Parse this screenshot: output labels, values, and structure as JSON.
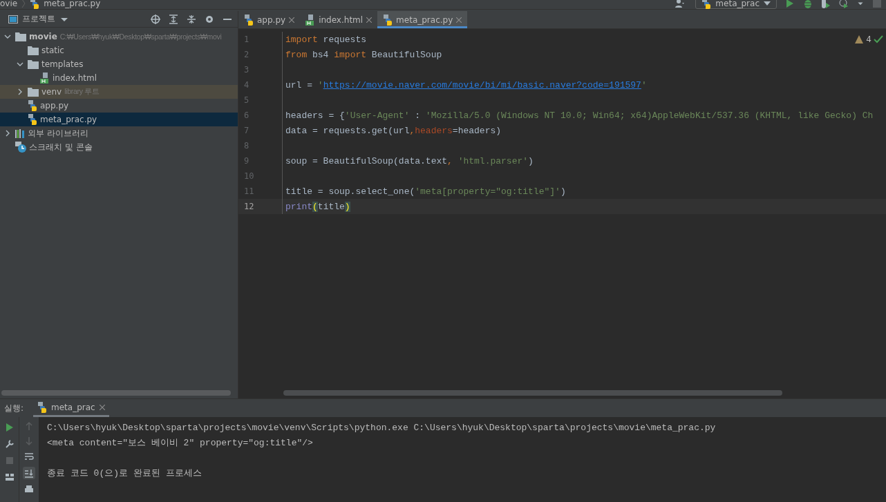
{
  "breadcrumb": {
    "project": "ovie",
    "file": "meta_prac.py"
  },
  "toolbar": {
    "run_config": "meta_prac"
  },
  "project_panel": {
    "title": "프로젝트",
    "tree": [
      {
        "label": "movie",
        "kind": "project_root",
        "hint": "C:₩Users₩hyuk₩Desktop₩sparta₩projects₩movi",
        "expanded": true,
        "selected": false,
        "children": [
          {
            "label": "static",
            "kind": "folder",
            "selected": false
          },
          {
            "label": "templates",
            "kind": "folder",
            "expanded": true,
            "selected": false,
            "children": [
              {
                "label": "index.html",
                "kind": "html",
                "selected": false
              }
            ]
          },
          {
            "label": "venv",
            "kind": "library_root",
            "hint": "library 루트",
            "expanded": false,
            "selected": false
          },
          {
            "label": "app.py",
            "kind": "python",
            "selected": false
          },
          {
            "label": "meta_prac.py",
            "kind": "python",
            "selected": true
          }
        ]
      },
      {
        "label": "외부 라이브러리",
        "kind": "libraries",
        "expanded": false,
        "selected": false
      },
      {
        "label": "스크래치 및 콘솔",
        "kind": "scratch",
        "selected": false
      }
    ]
  },
  "editor": {
    "tabs": [
      {
        "label": "app.py",
        "kind": "python",
        "selected": false
      },
      {
        "label": "index.html",
        "kind": "html",
        "selected": false
      },
      {
        "label": "meta_prac.py",
        "kind": "python",
        "selected": true
      }
    ],
    "warnings": "4",
    "lines": [
      {
        "number": "1",
        "current": false,
        "tokens": [
          {
            "kind": "keyword",
            "text": "import"
          },
          {
            "kind": "plain",
            "text": " requests"
          }
        ]
      },
      {
        "number": "2",
        "current": false,
        "tokens": [
          {
            "kind": "keyword",
            "text": "from"
          },
          {
            "kind": "plain",
            "text": " bs4 "
          },
          {
            "kind": "keyword",
            "text": "import"
          },
          {
            "kind": "plain",
            "text": " BeautifulSoup"
          }
        ]
      },
      {
        "number": "3",
        "current": false
      },
      {
        "number": "4",
        "current": false,
        "tokens": [
          {
            "kind": "plain",
            "text": "url = "
          },
          {
            "kind": "string",
            "text": "'"
          },
          {
            "kind": "link",
            "text": "https://movie.naver.com/movie/bi/mi/basic.naver?code=191597"
          },
          {
            "kind": "string",
            "text": "'"
          }
        ]
      },
      {
        "number": "5",
        "current": false
      },
      {
        "number": "6",
        "current": false,
        "tokens": [
          {
            "kind": "plain",
            "text": "headers = {"
          },
          {
            "kind": "string",
            "text": "'User-Agent'"
          },
          {
            "kind": "plain",
            "text": " : "
          },
          {
            "kind": "string",
            "text": "'Mozilla/5.0 (Windows NT 10.0; Win64; x64)AppleWebKit/537.36 (KHTML, like Gecko) Ch"
          }
        ]
      },
      {
        "number": "7",
        "current": false,
        "tokens": [
          {
            "kind": "plain",
            "text": "data = requests.get(url"
          },
          {
            "kind": "keyword",
            "text": ","
          },
          {
            "kind": "param",
            "text": "headers"
          },
          {
            "kind": "plain",
            "text": "=headers)"
          }
        ]
      },
      {
        "number": "8",
        "current": false
      },
      {
        "number": "9",
        "current": false,
        "tokens": [
          {
            "kind": "plain",
            "text": "soup = BeautifulSoup(data.text"
          },
          {
            "kind": "keyword",
            "text": ", "
          },
          {
            "kind": "string",
            "text": "'html.parser'"
          },
          {
            "kind": "plain",
            "text": ")"
          }
        ]
      },
      {
        "number": "10",
        "current": false
      },
      {
        "number": "11",
        "current": false,
        "tokens": [
          {
            "kind": "plain",
            "text": "title = soup.select_one("
          },
          {
            "kind": "string",
            "text": "'meta[property=\"og:title\"]'"
          },
          {
            "kind": "plain",
            "text": ")"
          }
        ]
      },
      {
        "number": "12",
        "current": true,
        "tokens": [
          {
            "kind": "builtin",
            "text": "print"
          },
          {
            "kind": "brace",
            "text": "("
          },
          {
            "kind": "plain",
            "text": "title"
          },
          {
            "kind": "brace",
            "text": ")"
          }
        ]
      }
    ]
  },
  "run_panel": {
    "label": "실행:",
    "tab": "meta_prac",
    "output": [
      {
        "kind": "command",
        "text": "C:\\Users\\hyuk\\Desktop\\sparta\\projects\\movie\\venv\\Scripts\\python.exe C:\\Users\\hyuk\\Desktop\\sparta\\projects\\movie\\meta_prac.py"
      },
      {
        "kind": "output",
        "text": "<meta content=\"보스 베이비 2\" property=\"og:title\"/>"
      },
      {
        "kind": "exit",
        "text": "종료 코드 0(으)로 완료된 프로세스"
      }
    ]
  }
}
